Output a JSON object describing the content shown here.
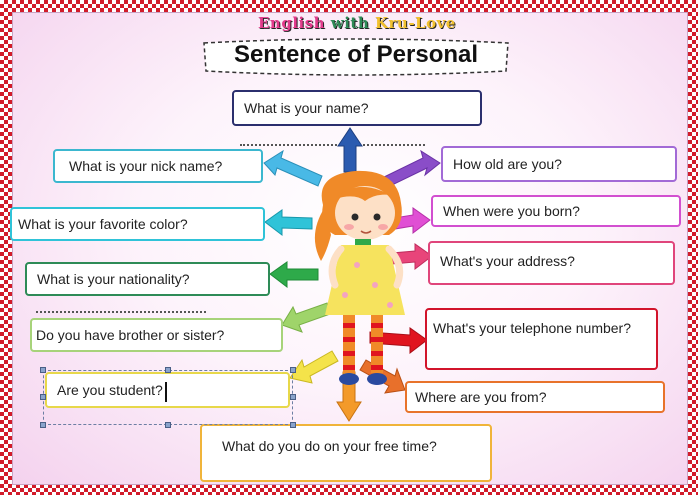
{
  "brand": {
    "parts": [
      {
        "text": "English ",
        "color": "#e23b8c"
      },
      {
        "text": "with ",
        "color": "#2e8b57"
      },
      {
        "text": "Kru-Love",
        "color": "#f2c12e"
      }
    ]
  },
  "title": "Sentence of Personal",
  "questions": {
    "name": "What is your name?",
    "nickname": "What is your nick name?",
    "age": "How old are you?",
    "favorite_color": "What is your favorite color?",
    "born": "When were you born?",
    "address": "What's your address?",
    "nationality": "What is your nationality?",
    "siblings": "Do you have brother or sister?",
    "telephone": "What's your telephone number?",
    "student": "Are you student?",
    "from": "Where are you from?",
    "free_time": "What do you do on your free time?"
  },
  "colors": {
    "border_checker": "#d21b2a",
    "box_name": "#2b2f6e",
    "box_nickname": "#3bb7cf",
    "box_age": "#a26ad6",
    "box_color": "#2fc3d8",
    "box_born": "#d24fd0",
    "box_address": "#e0457b",
    "box_nationality": "#2e8b57",
    "box_siblings": "#a7d37a",
    "box_telephone": "#d2142b",
    "box_student": "#e7d84a",
    "box_from": "#e8732b",
    "box_free_time": "#f0b43a"
  }
}
